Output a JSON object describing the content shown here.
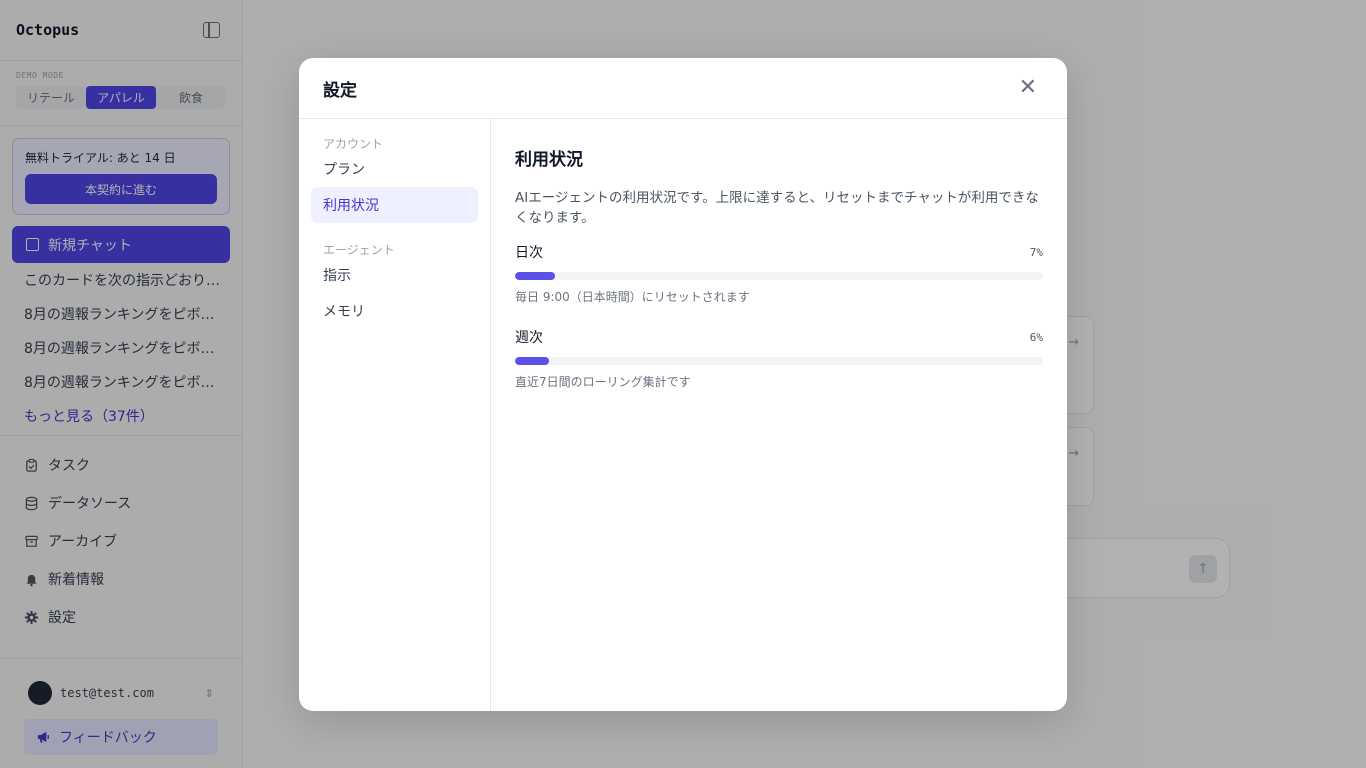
{
  "sidebar": {
    "logo": "Octopus",
    "demo_label": "DEMO MODE",
    "demo_tabs": [
      "リテール",
      "アパレル",
      "飲食"
    ],
    "trial_text": "無料トライアル: あと 14 日",
    "trial_button": "本契約に進む",
    "new_chat": "新規チャット",
    "history": [
      "このカードを次の指示どおり…",
      "8月の週報ランキングをピボ…",
      "8月の週報ランキングをピボ…",
      "8月の週報ランキングをピボ…"
    ],
    "show_more": "もっと見る（37件）",
    "nav": [
      {
        "label": "タスク",
        "icon": "clipboard-icon"
      },
      {
        "label": "データソース",
        "icon": "database-icon"
      },
      {
        "label": "アーカイブ",
        "icon": "archive-icon"
      },
      {
        "label": "新着情報",
        "icon": "bell-icon"
      },
      {
        "label": "設定",
        "icon": "gear-icon"
      }
    ],
    "user_email": "test@test.com",
    "feedback": "フィードバック"
  },
  "modal": {
    "title": "設定",
    "nav_sections": [
      {
        "heading": "アカウント",
        "items": [
          "プラン",
          "利用状況"
        ]
      },
      {
        "heading": "エージェント",
        "items": [
          "指示",
          "メモリ"
        ]
      }
    ],
    "active_item": "利用状況",
    "content": {
      "title": "利用状況",
      "description": "AIエージェントの利用状況です。上限に達すると、リセットまでチャットが利用できなくなります。",
      "usage": [
        {
          "label": "日次",
          "percent_text": "7%",
          "value": 0.07,
          "note": "毎日 9:00（日本時間）にリセットされます"
        },
        {
          "label": "週次",
          "percent_text": "6%",
          "value": 0.06,
          "note": "直近7日間のローリング集計です"
        }
      ]
    }
  },
  "colors": {
    "accent": "#4f46e5",
    "bar_fill": "#5b50e8",
    "bar_track": "#f1f3f6"
  }
}
